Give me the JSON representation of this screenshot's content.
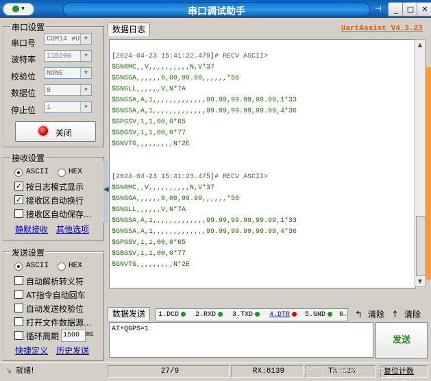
{
  "window": {
    "title": "串口调试助手",
    "sysmenu_label": "▾",
    "buttons": {
      "pin": "⊣",
      "minimize": "_",
      "maximize": "□",
      "close": "✕"
    }
  },
  "serial_settings": {
    "title": "串口设置",
    "port_label": "串口号",
    "port_value": "COM14 #US",
    "baud_label": "波特率",
    "baud_value": "115200",
    "parity_label": "校验位",
    "parity_value": "NONE",
    "databits_label": "数据位",
    "databits_value": "8",
    "stopbits_label": "停止位",
    "stopbits_value": "1",
    "close_button": "关闭"
  },
  "receive_settings": {
    "title": "接收设置",
    "ascii": "ASCII",
    "hex": "HEX",
    "log_mode": "按日志模式显示",
    "auto_newline": "接收区自动换行",
    "auto_save": "接收区自动保存...",
    "link_silent": "静默接收",
    "link_other": "其他选项"
  },
  "send_settings": {
    "title": "发送设置",
    "ascii": "ASCII",
    "hex": "HEX",
    "auto_escape": "自动解析转义符",
    "at_enter": "AT指令自动回车",
    "auto_checksum": "自动发送校验位",
    "open_file": "打开文件数据源...",
    "loop": "循环周期",
    "loop_value": "1500",
    "loop_unit": "ms",
    "link_shortcut": "快捷定义",
    "link_history": "历史发送"
  },
  "log": {
    "tab": "数据日志",
    "version": "UartAssist V4.3.23",
    "blocks": [
      {
        "header": "[2024-04-23 15:41:22.479]# RECV ASCII>",
        "lines": [
          "$GNRMC,,V,,,,,,,,,,N,V*37",
          "$GNGGA,,,,,,0,00,99.99,,,,,,*56",
          "$GNGLL,,,,,,V,N*7A",
          "$GNGSA,A,1,,,,,,,,,,,,,99.99,99.99,99.99,1*33",
          "$GNGSA,A,1,,,,,,,,,,,,,99.99,99.99,99.99,4*36",
          "$GPGSV,1,1,00,0*65",
          "$GBGSV,1,1,00,0*77",
          "$GNVTG,,,,,,,,,N*2E"
        ]
      },
      {
        "header": "[2024-04-23 15:41:23.475]# RECV ASCII>",
        "lines": [
          "$GNRMC,,V,,,,,,,,,,N,V*37",
          "$GNGGA,,,,,,0,00,99.99,,,,,,*56",
          "$GNGLL,,,,,,V,N*7A",
          "$GNGSA,A,1,,,,,,,,,,,,,99.99,99.99,99.99,1*33",
          "$GNGSA,A,1,,,,,,,,,,,,,99.99,99.99,99.99,4*36",
          "$GPGSV,1,1,00,0*65",
          "$GBGSV,1,1,00,0*77",
          "$GNVTG,,,,,,,,,N*2E"
        ]
      }
    ]
  },
  "send": {
    "tab": "数据发送",
    "signals": [
      {
        "label": "1.DCD",
        "color": "#1a9a1a"
      },
      {
        "label": "2.RXD",
        "color": "#1a9a1a"
      },
      {
        "label": "3.TXD",
        "color": "#1a9a1a"
      },
      {
        "label": "4.DTR",
        "color": "#e00000"
      },
      {
        "label": "5.GND",
        "color": "#1a9a1a"
      },
      {
        "label": "6.",
        "color": ""
      }
    ],
    "clear1": "清除",
    "clear2": "清除",
    "input_value": "AT+QGPS=1",
    "send_button": "发送"
  },
  "status": {
    "ready": "就绪!",
    "count": "27/9",
    "rx": "RX:6139",
    "tx": "TX:123",
    "reset": "复位计数"
  },
  "watermark": "CSDN @嵌入式小白"
}
